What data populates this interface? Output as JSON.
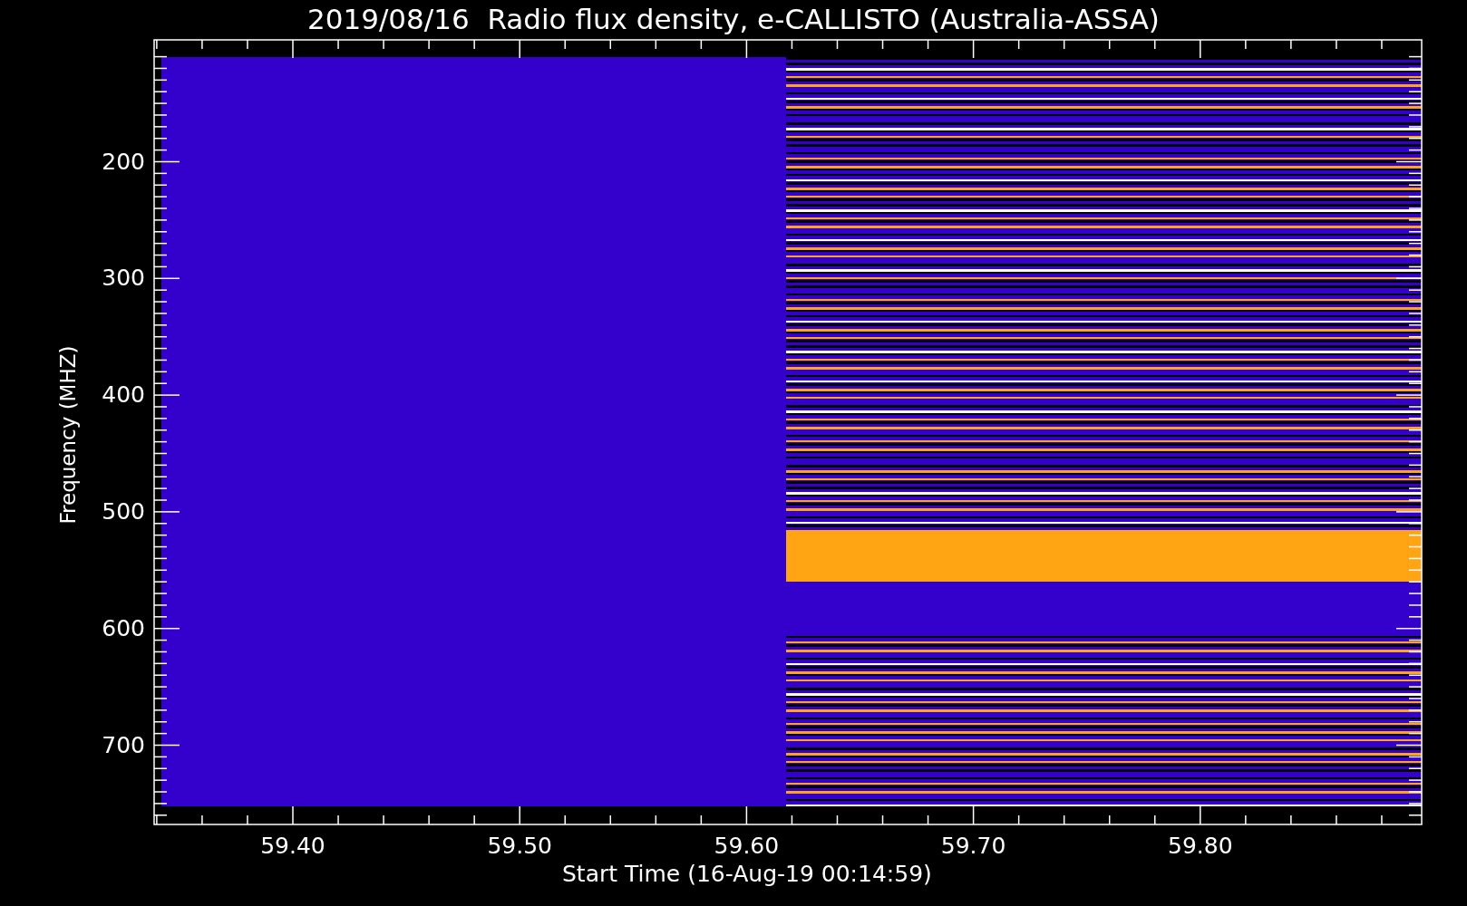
{
  "title": "2019/08/16  Radio flux density, e-CALLISTO (Australia-ASSA)",
  "y_axis": {
    "label": "Frequency (MHZ)",
    "ticks": [
      "200",
      "300",
      "400",
      "500",
      "600",
      "700"
    ]
  },
  "x_axis": {
    "label": "Start Time (16-Aug-19 00:14:59)",
    "ticks": [
      "59.40",
      "59.50",
      "59.60",
      "59.70",
      "59.80"
    ]
  }
}
